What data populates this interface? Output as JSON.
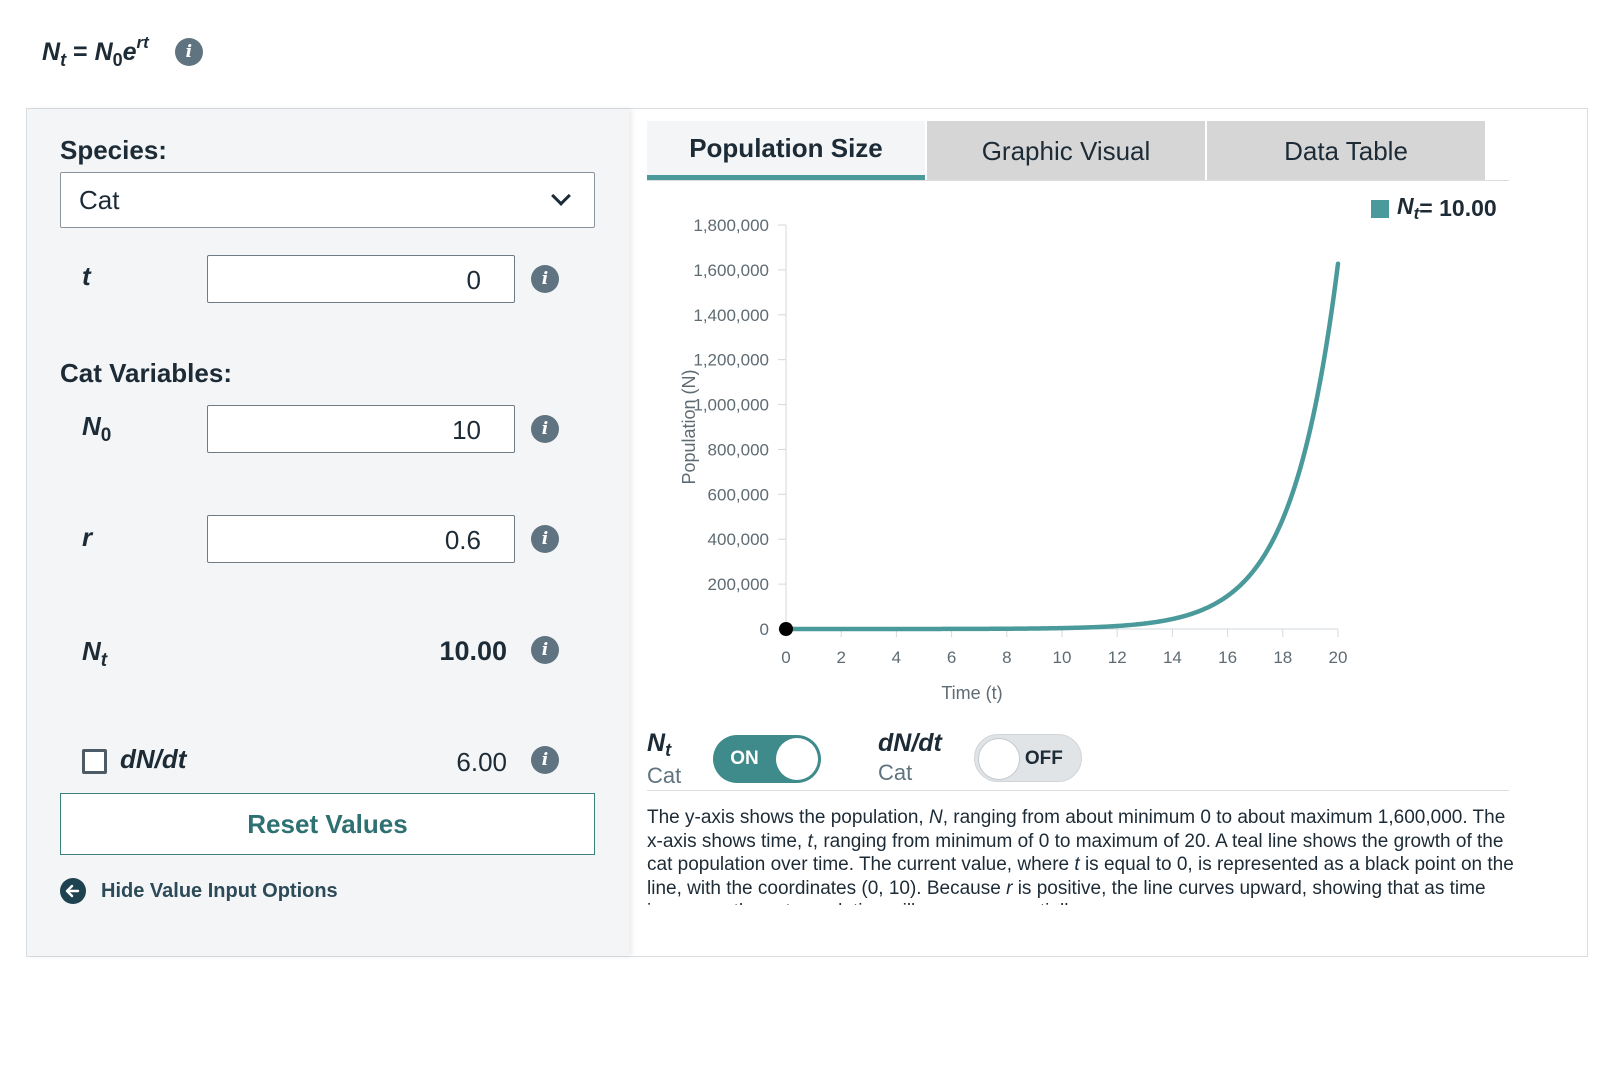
{
  "header": {
    "formula": {
      "lhs": "N",
      "lhs_sub": "t",
      "eq": " = ",
      "rhs": "N",
      "rhs_sub": "0",
      "base": "e",
      "exp": "rt"
    }
  },
  "left_panel": {
    "species_label": "Species:",
    "species_selected": "Cat",
    "t": {
      "label": "t",
      "value": "0"
    },
    "section_title": "Cat Variables:",
    "n0": {
      "label": "N",
      "label_sub": "0",
      "value": "10"
    },
    "r": {
      "label": "r",
      "value": "0.6"
    },
    "nt": {
      "label": "N",
      "label_sub": "t",
      "value": "10.00"
    },
    "dndt": {
      "label": "dN/dt",
      "value": "6.00",
      "checked": false
    },
    "reset_label": "Reset Values",
    "hide_label": "Hide Value Input Options"
  },
  "tabs": [
    {
      "label": "Population Size",
      "active": true
    },
    {
      "label": "Graphic Visual",
      "active": false
    },
    {
      "label": "Data Table",
      "active": false
    }
  ],
  "legend": {
    "sym": "N",
    "sym_sub": "t",
    "text": " = 10.00"
  },
  "chart_data": {
    "type": "line",
    "ylabel": "Population (N)",
    "xlabel": "Time (t)",
    "xlim": [
      0,
      20
    ],
    "ylim": [
      0,
      1800000
    ],
    "xticks": [
      0,
      2,
      4,
      6,
      8,
      10,
      12,
      14,
      16,
      18,
      20
    ],
    "yticks": [
      0,
      200000,
      400000,
      600000,
      800000,
      1000000,
      1200000,
      1400000,
      1600000,
      1800000
    ],
    "ytick_labels": [
      "0",
      "200,000",
      "400,000",
      "600,000",
      "800,000",
      "1,000,000",
      "1,200,000",
      "1,400,000",
      "1,600,000",
      "1,800,000"
    ],
    "series": [
      {
        "N0": 10,
        "r": 0.6,
        "color": "#4a9a9b"
      }
    ],
    "current_point": {
      "x": 0,
      "y": 10,
      "color": "#000000"
    },
    "grid": false
  },
  "toggles": [
    {
      "sym": "N",
      "sym_sub": "t",
      "sub_label": "Cat",
      "state": "ON"
    },
    {
      "sym": "dN/dt",
      "sym_sub": "",
      "sub_label": "Cat",
      "state": "OFF"
    }
  ],
  "description": {
    "t1": "The y-axis shows the population, ",
    "n": "N",
    "t2": ", ranging from about minimum 0 to about maximum 1,600,000. The x-axis shows time, ",
    "t": "t",
    "t3": ", ranging from minimum of 0 to maximum of 20. A teal line shows the growth of the cat population over time. The current value, where ",
    "t_again": "t",
    "t4": " is equal to 0, is represented as a black point on the line, with the coordinates (0, 10). Because ",
    "r": "r",
    "t5": " is positive, the line curves upward, showing that as time increases the cat population will grow exponentially."
  },
  "colors": {
    "accent": "#4a9a9b",
    "panel_bg": "#f3f5f7",
    "text": "#1d2b36",
    "info": "#5f7380"
  }
}
